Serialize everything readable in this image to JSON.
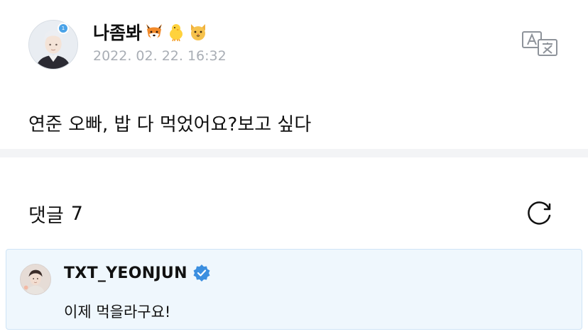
{
  "post": {
    "author": {
      "name": "나좀봐",
      "emojis": [
        "fox-emoji",
        "chick-emoji",
        "cat-emoji"
      ],
      "level_badge": "1"
    },
    "timestamp": "2022. 02. 22. 16:32",
    "body": "연준 오빠, 밥 다 먹었어요?보고 싶다",
    "translate_icon": "translate-icon"
  },
  "comments": {
    "label": "댓글",
    "count": "7",
    "refresh_icon": "refresh-icon",
    "items": [
      {
        "author": "TXT_YEONJUN",
        "verified": true,
        "text": "이제 먹을라구요!"
      }
    ]
  },
  "colors": {
    "timestamp": "#a9aeb5",
    "divider": "#f3f4f6",
    "comment_bg": "#eff7fd",
    "comment_border": "#cfe4f6",
    "verified": "#3b8fe0"
  }
}
